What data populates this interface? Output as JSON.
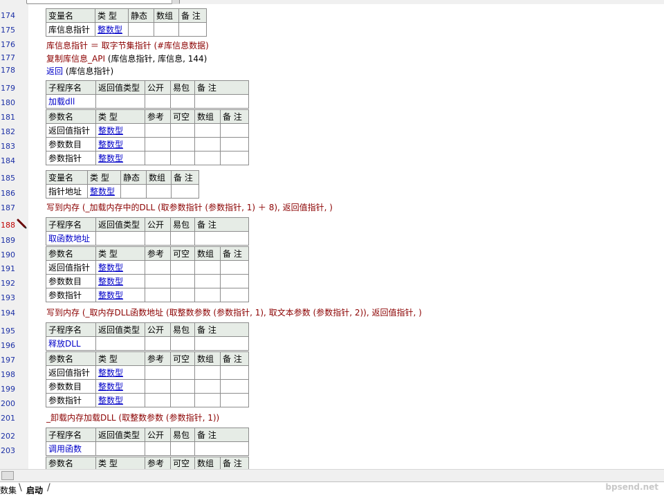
{
  "line_numbers": [
    "174",
    "175",
    "176",
    "177",
    "178",
    "179",
    "180",
    "181",
    "182",
    "183",
    "184",
    "185",
    "186",
    "187",
    "188",
    "189",
    "190",
    "191",
    "192",
    "193",
    "194",
    "195",
    "196",
    "197",
    "198",
    "199",
    "200",
    "201",
    "202",
    "203"
  ],
  "tables": {
    "var_header": [
      "变量名",
      "类 型",
      "静态",
      "数组",
      "备 注"
    ],
    "var1_row": [
      "库信息指针",
      "整数型"
    ],
    "sub_header": [
      "子程序名",
      "返回值类型",
      "公开",
      "易包",
      "备 注"
    ],
    "param_header": [
      "参数名",
      "类 型",
      "参考",
      "可空",
      "数组",
      "备 注"
    ],
    "param_rows": [
      [
        "返回值指针",
        "整数型"
      ],
      [
        "参数数目",
        "整数型"
      ],
      [
        "参数指针",
        "整数型"
      ]
    ],
    "sub1_name": "加载dll",
    "var2_row": [
      "指针地址",
      "整数型"
    ],
    "sub2_name": "取函数地址",
    "sub3_name": "释放DLL",
    "sub4_name": "调用函数"
  },
  "code": {
    "l176": "库信息指针 ＝ 取字节集指针 (#库信息数据)",
    "l177_fn": "复制库信息_API",
    "l177_args": " (库信息指针, 库信息, 144)",
    "l178_kw": "返回",
    "l178_args": " (库信息指针)",
    "l187_fn": "写到内存",
    "l187_rest": " (_加载内存中的DLL (取参数指针 (参数指针, 1) ＋ 8), 返回值指针, )",
    "l194_fn": "写到内存",
    "l194_rest": " (_取内存DLL函数地址 (取整数参数 (参数指针, 1), 取文本参数 (参数指针, 2)), 返回值指针, )",
    "l201": "_卸载内存加载DLL (取整数参数 (参数指针, 1))"
  },
  "tabs": {
    "inactive": "数集",
    "active": "启动"
  },
  "watermark": "bpsend.net",
  "colors": {
    "line_number": "#1b2fa5",
    "active_line": "#c00000",
    "keyword": "#8b0000",
    "type_link": "#0000c8",
    "header_bg": "#e6ece6"
  }
}
